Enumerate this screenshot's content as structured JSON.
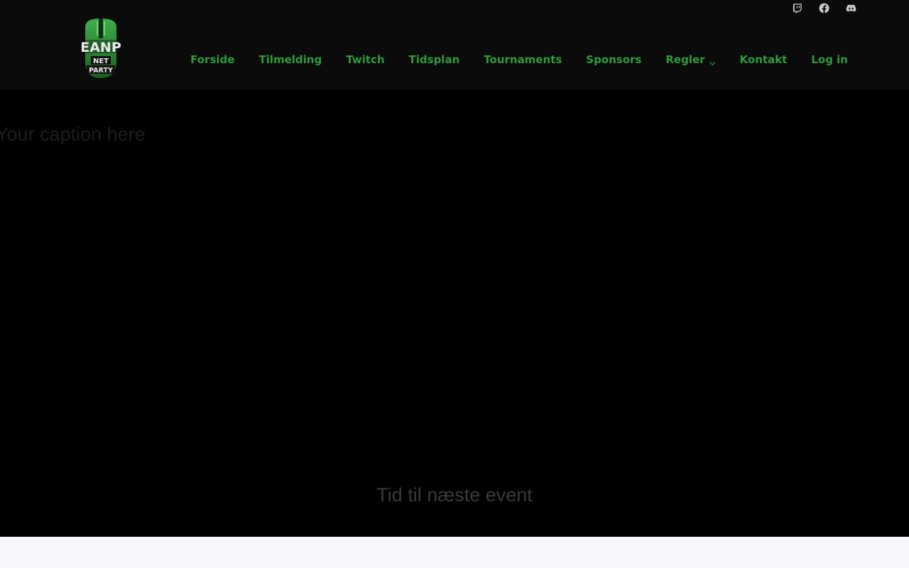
{
  "header": {
    "logo": {
      "line1": "EANP",
      "line2": "NET",
      "line3": "PARTY"
    },
    "social": [
      {
        "icon": "twitch-icon"
      },
      {
        "icon": "facebook-icon"
      },
      {
        "icon": "discord-icon"
      }
    ],
    "nav": [
      {
        "label": "Forside"
      },
      {
        "label": "Tilmelding"
      },
      {
        "label": "Twitch"
      },
      {
        "label": "Tidsplan"
      },
      {
        "label": "Tournaments"
      },
      {
        "label": "Sponsors"
      },
      {
        "label": "Regler"
      },
      {
        "label": "Kontakt"
      },
      {
        "label": "Log in"
      }
    ]
  },
  "hero": {
    "caption": "Your caption here",
    "countdown_title": "Tid til næste event"
  },
  "colors": {
    "accent": "#2f9a3c",
    "header_bg": "#0b0b0b",
    "hero_bg": "#000000",
    "page_bg": "#f6f8fc"
  }
}
